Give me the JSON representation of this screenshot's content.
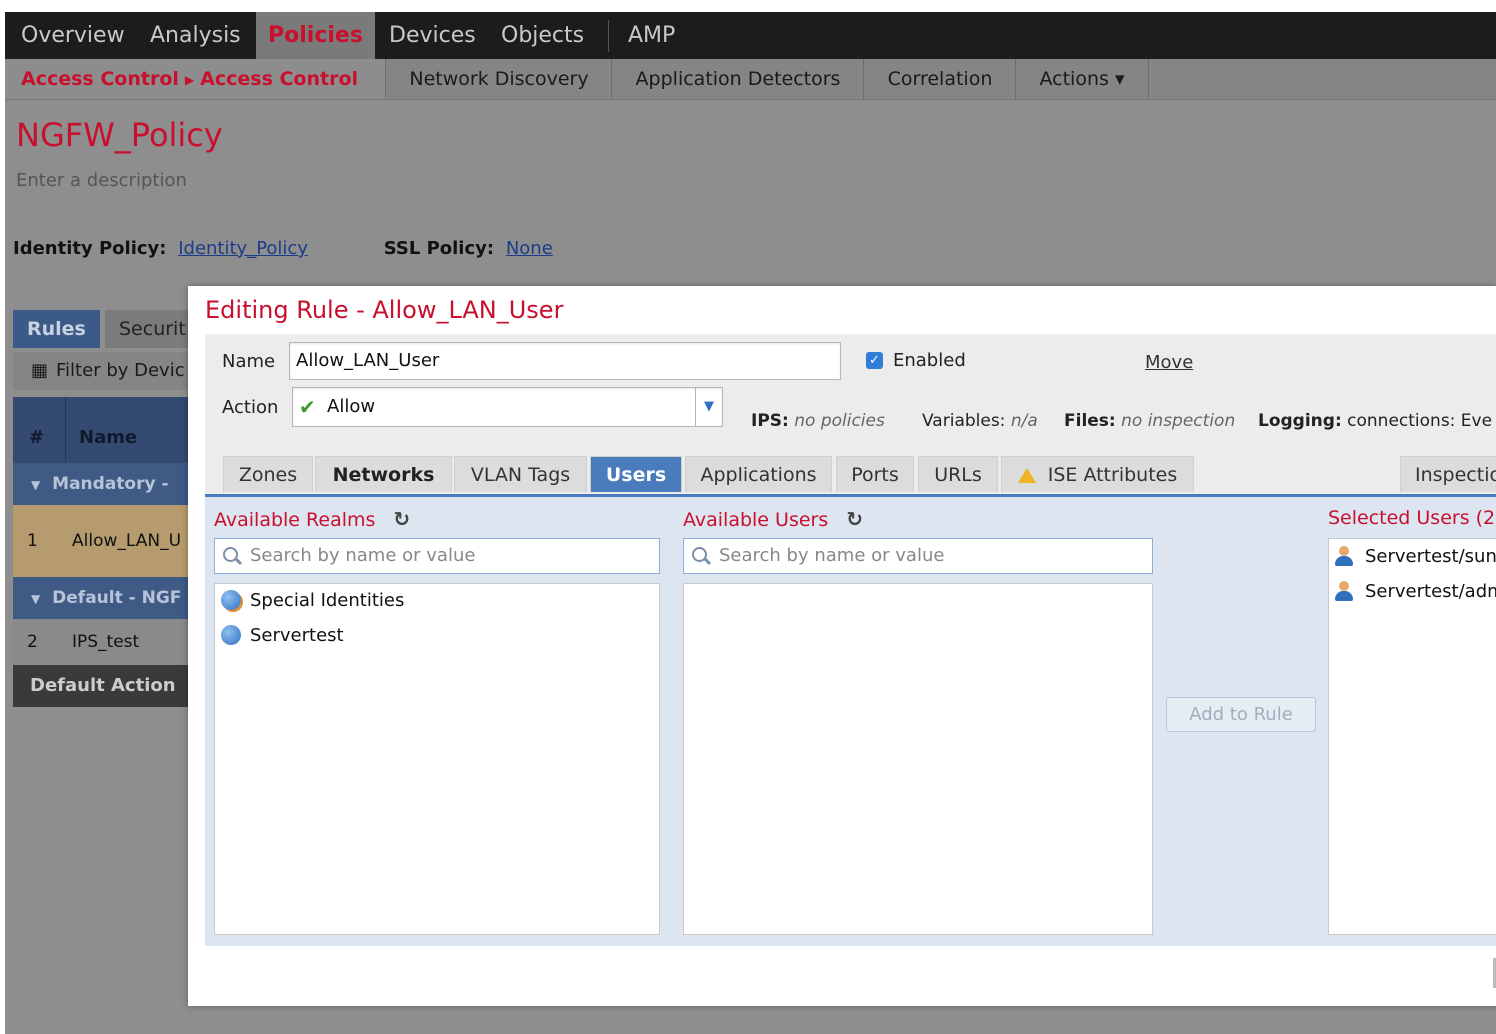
{
  "top_nav": {
    "items": [
      "Overview",
      "Analysis",
      "Policies",
      "Devices",
      "Objects",
      "AMP"
    ],
    "active": "Policies"
  },
  "sub_nav": {
    "breadcrumb": [
      "Access Control",
      "Access Control"
    ],
    "items": [
      "Network Discovery",
      "Application Detectors",
      "Correlation",
      "Actions ▾"
    ]
  },
  "policy": {
    "title": "NGFW_Policy",
    "description_placeholder": "Enter a description",
    "identity_label": "Identity Policy:",
    "identity_value": "Identity_Policy",
    "ssl_label": "SSL Policy:",
    "ssl_value": "None"
  },
  "rules_panel": {
    "tabs": [
      "Rules",
      "Securit"
    ],
    "filter_label": "Filter by Devic",
    "columns": [
      "#",
      "Name"
    ],
    "groups": [
      {
        "label": "Mandatory - ",
        "rows": [
          {
            "num": "1",
            "name": "Allow_LAN_U"
          }
        ]
      },
      {
        "label": "Default - NGF",
        "rows": [
          {
            "num": "2",
            "name": "IPS_test"
          }
        ]
      }
    ],
    "default_action": "Default Action"
  },
  "modal": {
    "title": "Editing Rule - Allow_LAN_User",
    "name_label": "Name",
    "name_value": "Allow_LAN_User",
    "enabled_label": "Enabled",
    "enabled": true,
    "move_label": "Move",
    "action_label": "Action",
    "action_value": "Allow",
    "ips_label": "IPS:",
    "ips_value": "no policies",
    "variables_label": "Variables:",
    "variables_value": "n/a",
    "files_label": "Files:",
    "files_value": "no inspection",
    "logging_label": "Logging:",
    "logging_value": "connections: Eve",
    "tabs": [
      "Zones",
      "Networks",
      "VLAN Tags",
      "Users",
      "Applications",
      "Ports",
      "URLs",
      "ISE Attributes",
      "Inspectio"
    ],
    "active_tab": "Users",
    "available_realms": {
      "title": "Available Realms",
      "search_placeholder": "Search by name or value",
      "items": [
        "Special Identities",
        "Servertest"
      ]
    },
    "available_users": {
      "title": "Available Users",
      "search_placeholder": "Search by name or value",
      "items": []
    },
    "add_button": "Add to Rule",
    "selected_users": {
      "title": "Selected Users (2",
      "items": [
        "Servertest/sun",
        "Servertest/adm"
      ]
    }
  }
}
